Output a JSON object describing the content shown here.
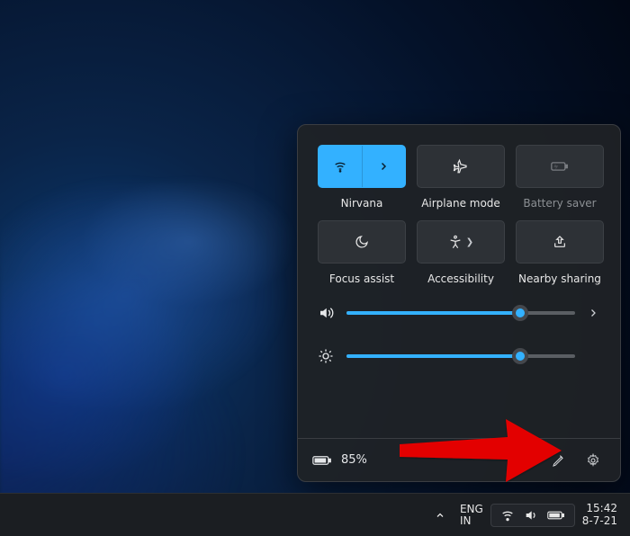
{
  "quick_settings": {
    "tiles": [
      {
        "id": "wifi",
        "label": "Nirvana",
        "active": true,
        "split": true
      },
      {
        "id": "airplane",
        "label": "Airplane mode",
        "active": false
      },
      {
        "id": "battery-saver",
        "label": "Battery saver",
        "active": false,
        "disabled": true
      },
      {
        "id": "focus-assist",
        "label": "Focus assist",
        "active": false
      },
      {
        "id": "accessibility",
        "label": "Accessibility",
        "active": false,
        "has_chevron": true
      },
      {
        "id": "nearby-share",
        "label": "Nearby sharing",
        "active": false
      }
    ],
    "volume_percent": 76,
    "brightness_percent": 76,
    "battery_text": "85%"
  },
  "taskbar": {
    "lang_line1": "ENG",
    "lang_line2": "IN",
    "time": "15:42",
    "date": "8-7-21"
  }
}
